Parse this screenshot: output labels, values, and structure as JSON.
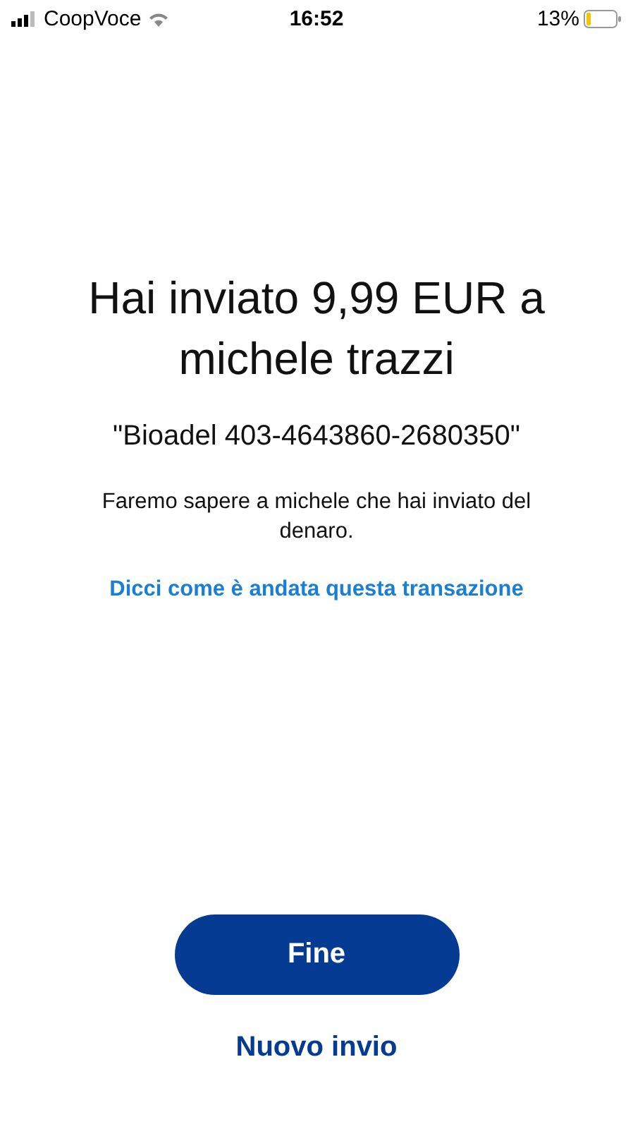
{
  "status_bar": {
    "carrier": "CoopVoce",
    "time": "16:52",
    "battery": "13%"
  },
  "title": "Hai inviato 9,99 EUR a michele trazzi",
  "note": "\"Bioadel 403-4643860-2680350\"",
  "message": "Faremo sapere a michele che hai inviato del denaro.",
  "feedback_link": "Dicci come è andata questa transazione",
  "buttons": [
    {
      "label": "Fine",
      "kind": "primary"
    },
    {
      "label": "Nuovo invio",
      "kind": "text"
    }
  ]
}
